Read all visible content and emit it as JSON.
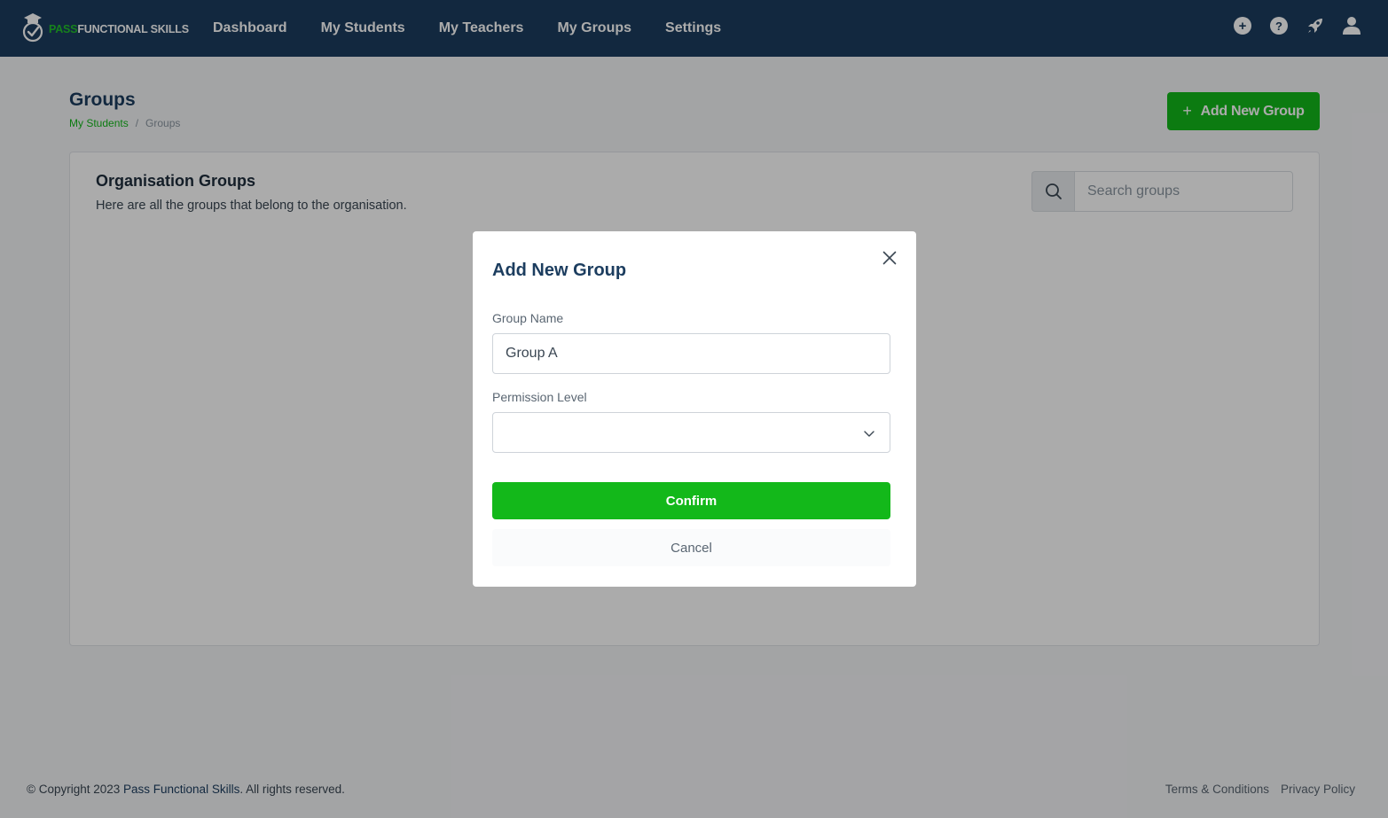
{
  "app": {
    "logo_pass": "PASS",
    "logo_rest": "FUNCTIONAL SKILLS"
  },
  "nav": {
    "items": [
      {
        "label": "Dashboard"
      },
      {
        "label": "My Students"
      },
      {
        "label": "My Teachers"
      },
      {
        "label": "My Groups"
      },
      {
        "label": "Settings"
      }
    ],
    "icons": [
      "plus-circle-icon",
      "help-circle-icon",
      "rocket-icon",
      "user-icon"
    ],
    "plus_glyph": "+",
    "help_glyph": "?"
  },
  "page": {
    "title": "Groups",
    "breadcrumb": {
      "link": "My Students",
      "separator": "/",
      "current": "Groups"
    },
    "add_button_label": "Add New Group",
    "add_button_plus": "+"
  },
  "card": {
    "title": "Organisation Groups",
    "subtitle": "Here are all the groups that belong to the organisation.",
    "search_placeholder": "Search groups"
  },
  "modal": {
    "title": "Add New Group",
    "group_name_label": "Group Name",
    "group_name_value": "Group A",
    "permission_label": "Permission Level",
    "permission_value": "",
    "confirm_label": "Confirm",
    "cancel_label": "Cancel"
  },
  "footer": {
    "copyright_prefix": "© Copyright 2023 ",
    "copyright_brand": "Pass Functional Skills",
    "copyright_suffix": ". All rights reserved.",
    "terms": "Terms & Conditions",
    "privacy": "Privacy Policy"
  },
  "colors": {
    "navbar": "#1c3d5f",
    "accent_green": "#13b81a",
    "overlay": "rgba(0,0,0,0.33)"
  }
}
